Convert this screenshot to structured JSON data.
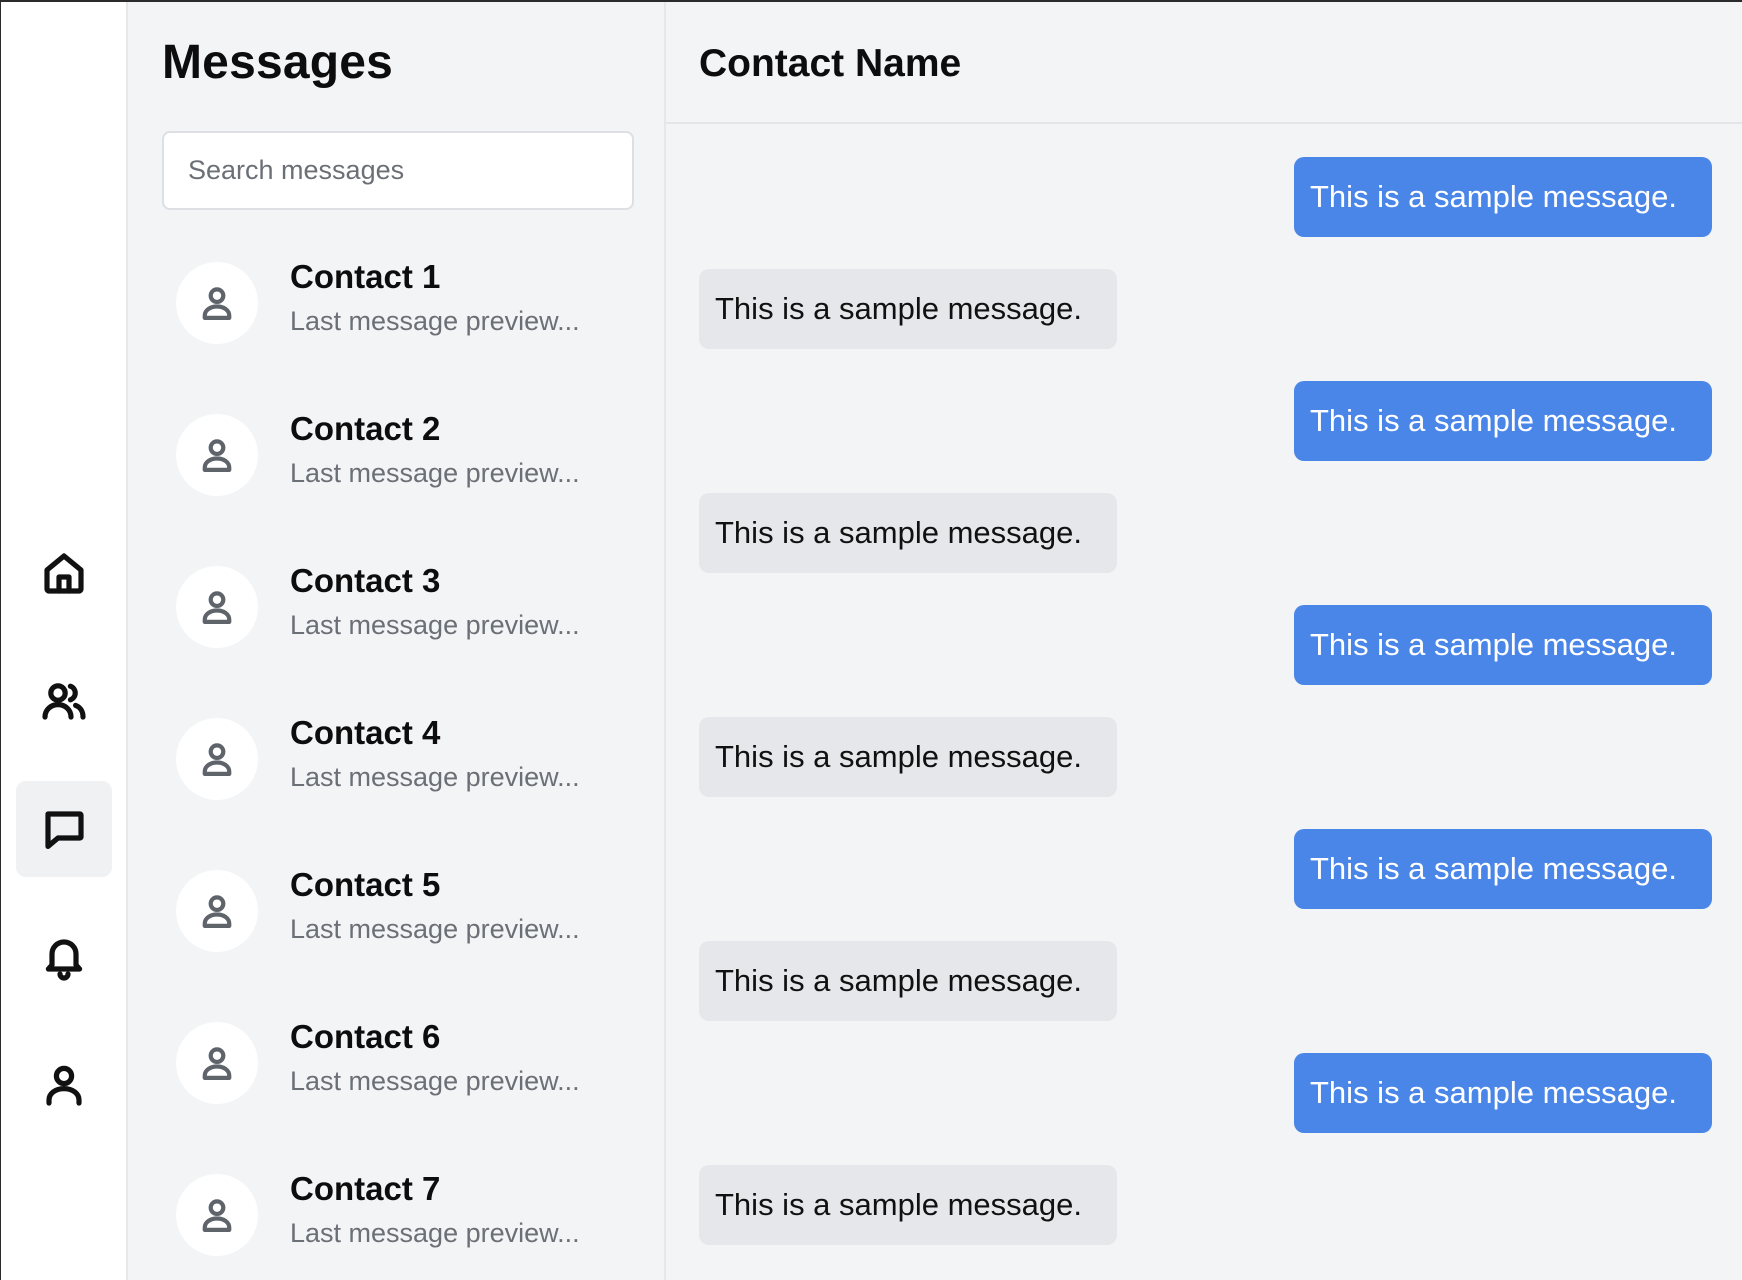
{
  "sidebar": {
    "items": [
      {
        "name": "home",
        "icon": "home-icon",
        "active": false
      },
      {
        "name": "contacts",
        "icon": "users-icon",
        "active": false
      },
      {
        "name": "messages",
        "icon": "chat-icon",
        "active": true
      },
      {
        "name": "notifications",
        "icon": "bell-icon",
        "active": false
      },
      {
        "name": "profile",
        "icon": "user-icon",
        "active": false
      }
    ]
  },
  "conversations": {
    "title": "Messages",
    "search_placeholder": "Search messages",
    "contacts": [
      {
        "name": "Contact 1",
        "preview": "Last message preview..."
      },
      {
        "name": "Contact 2",
        "preview": "Last message preview..."
      },
      {
        "name": "Contact 3",
        "preview": "Last message preview..."
      },
      {
        "name": "Contact 4",
        "preview": "Last message preview..."
      },
      {
        "name": "Contact 5",
        "preview": "Last message preview..."
      },
      {
        "name": "Contact 6",
        "preview": "Last message preview..."
      },
      {
        "name": "Contact 7",
        "preview": "Last message preview..."
      }
    ]
  },
  "chat": {
    "contact_name": "Contact Name",
    "messages": [
      {
        "direction": "outgoing",
        "text": "This is a sample message."
      },
      {
        "direction": "incoming",
        "text": "This is a sample message."
      },
      {
        "direction": "outgoing",
        "text": "This is a sample message."
      },
      {
        "direction": "incoming",
        "text": "This is a sample message."
      },
      {
        "direction": "outgoing",
        "text": "This is a sample message."
      },
      {
        "direction": "incoming",
        "text": "This is a sample message."
      },
      {
        "direction": "outgoing",
        "text": "This is a sample message."
      },
      {
        "direction": "incoming",
        "text": "This is a sample message."
      },
      {
        "direction": "outgoing",
        "text": "This is a sample message."
      },
      {
        "direction": "incoming",
        "text": "This is a sample message."
      }
    ]
  },
  "colors": {
    "outgoing_bubble": "#4a86e8",
    "incoming_bubble": "#e5e7eb",
    "panel_background": "#f3f4f6"
  }
}
